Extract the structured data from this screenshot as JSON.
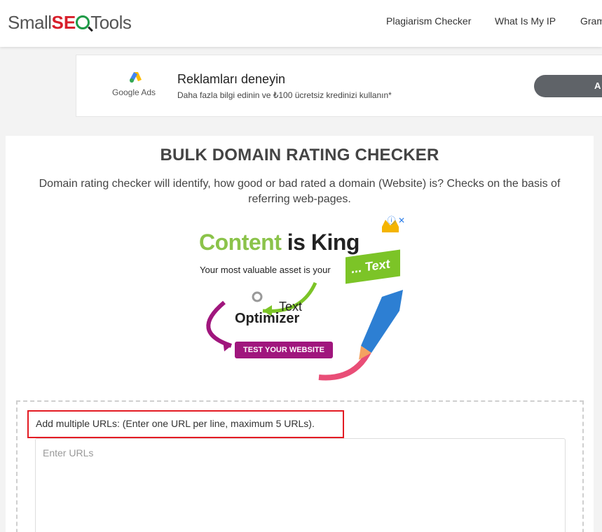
{
  "header": {
    "logo": {
      "part1": "Small",
      "part2": "SE",
      "part3": "Tools"
    },
    "nav": [
      "Plagiarism Checker",
      "What Is My IP",
      "Gram"
    ]
  },
  "ad_banner": {
    "brand": "Google Ads",
    "title": "Reklamları deneyin",
    "subtitle": "Daha fazla bilgi edinin ve ₺100 ücretsiz kredinizi kullanın*",
    "button": "A"
  },
  "main": {
    "title": "BULK DOMAIN RATING CHECKER",
    "description": "Domain rating checker will identify, how good or bad rated a domain (Website) is? Checks on the basis of referring web-pages."
  },
  "promo": {
    "headline_green": "Content ",
    "headline_dark": "is King",
    "sub": "Your most valuable asset is your",
    "tag": "... Text",
    "logo_top": "Text",
    "logo_bottom": "Optimizer",
    "cta": "TEST YOUR WEBSITE",
    "close": "ⓘ ✕"
  },
  "form": {
    "hint": "Add multiple URLs: (Enter one URL per line, maximum 5 URLs).",
    "placeholder": "Enter URLs",
    "value": ""
  },
  "colors": {
    "accent_red": "#e31b23",
    "brand_green": "#1e9b47",
    "promo_purple": "#a0167d",
    "promo_green": "#7cc427"
  }
}
